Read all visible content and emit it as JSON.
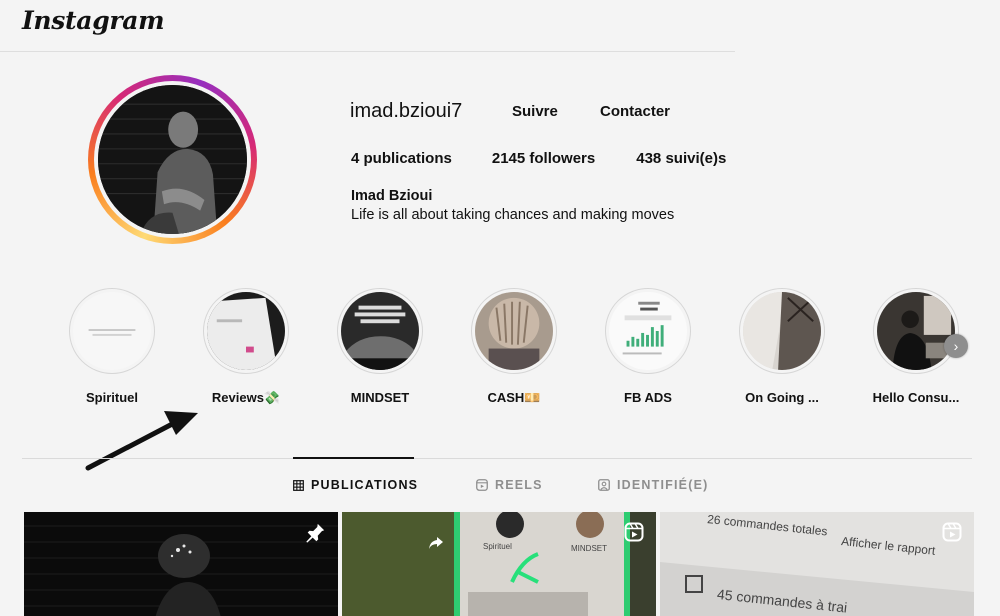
{
  "app": {
    "logo": "Instagram"
  },
  "profile": {
    "username": "imad.bzioui7",
    "follow_label": "Suivre",
    "contact_label": "Contacter",
    "stats": {
      "publications": "4 publications",
      "followers": "2145 followers",
      "following": "438 suivi(e)s"
    },
    "full_name": "Imad Bzioui",
    "bio": "Life is all about taking chances and making moves"
  },
  "highlights": [
    {
      "label": "Spirituel"
    },
    {
      "label": "Reviews💸"
    },
    {
      "label": "MINDSET"
    },
    {
      "label": "CASH💴"
    },
    {
      "label": "FB ADS"
    },
    {
      "label": "On Going ..."
    },
    {
      "label": "Hello Consu..."
    }
  ],
  "tabs": {
    "publications": "PUBLICATIONS",
    "reels": "REELS",
    "tagged": "IDENTIFIÉ(E)"
  },
  "posts": {
    "post3_line1": "26 commandes totales",
    "post3_line2": "Afficher le rapport",
    "post3_line3": "45 commandes à trai",
    "post2_label1": "Spirituel",
    "post2_label2": "MINDSET"
  },
  "icons": {
    "next": "chevron-right-icon",
    "pin": "pin-icon",
    "reel": "reel-icon"
  },
  "colors": {
    "background": "#f4f4f4",
    "text": "#111111",
    "muted": "#8e8e8e",
    "story_ring_start": "#feda75",
    "story_ring_end": "#962fbf"
  }
}
